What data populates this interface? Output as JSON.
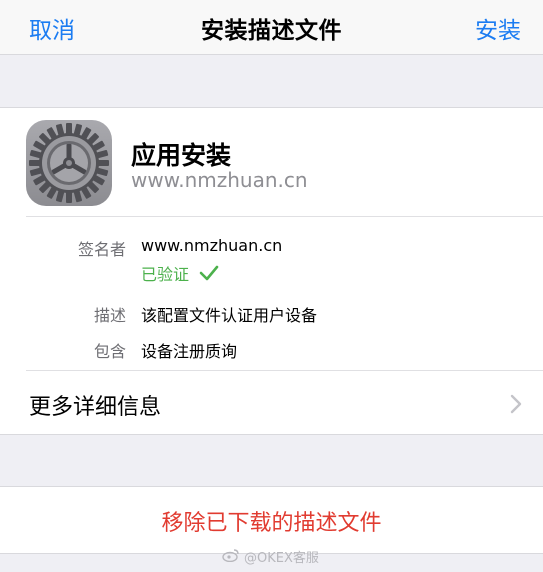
{
  "navbar": {
    "cancel_label": "取消",
    "title": "安装描述文件",
    "install_label": "安装"
  },
  "profile": {
    "icon": "settings-gear-icon",
    "name": "应用安装",
    "domain": "www.nmzhuan.cn"
  },
  "details": {
    "signer_label": "签名者",
    "signer_value": "www.nmzhuan.cn",
    "verified_text": "已验证",
    "description_label": "描述",
    "description_value": "该配置文件认证用户设备",
    "contains_label": "包含",
    "contains_value": "设备注册质询"
  },
  "more_info_label": "更多详细信息",
  "remove_label": "移除已下载的描述文件",
  "watermark_text": "@OKEX客服",
  "colors": {
    "link_blue": "#1b7cf2",
    "verified_green": "#4cb14c",
    "destructive_red": "#e13b30",
    "background": "#efeff4"
  }
}
